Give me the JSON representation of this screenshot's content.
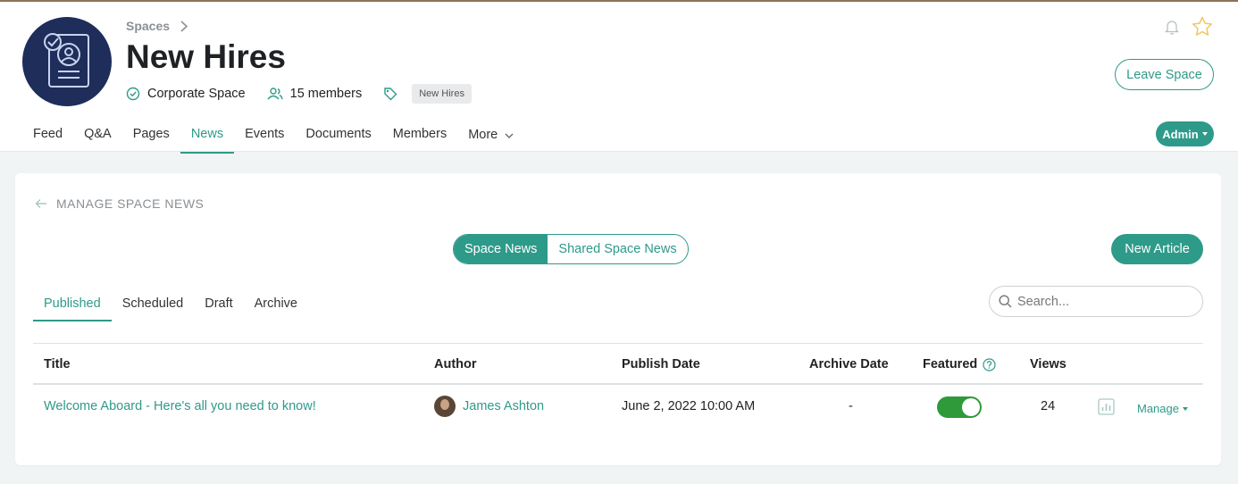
{
  "header": {
    "breadcrumb": "Spaces",
    "title": "New Hires",
    "space_type": "Corporate Space",
    "members": "15 members",
    "tag": "New Hires",
    "leave_label": "Leave Space",
    "admin_label": "Admin"
  },
  "nav": {
    "tabs": [
      "Feed",
      "Q&A",
      "Pages",
      "News",
      "Events",
      "Documents",
      "Members",
      "More"
    ],
    "active": "News"
  },
  "card": {
    "heading": "MANAGE SPACE NEWS",
    "segments": [
      "Space News",
      "Shared Space News"
    ],
    "active_segment": "Space News",
    "new_article_label": "New Article",
    "subtabs": [
      "Published",
      "Scheduled",
      "Draft",
      "Archive"
    ],
    "active_subtab": "Published",
    "search_placeholder": "Search..."
  },
  "table": {
    "columns": [
      "Title",
      "Author",
      "Publish Date",
      "Archive Date",
      "Featured",
      "Views"
    ],
    "rows": [
      {
        "title": "Welcome Aboard - Here's all you need to know!",
        "author": "James Ashton",
        "publish_date": "June 2, 2022 10:00 AM",
        "archive_date": "-",
        "featured": true,
        "views": "24",
        "manage_label": "Manage"
      }
    ]
  },
  "colors": {
    "accent": "#2e9a8a",
    "toggle_on": "#2e9a3a",
    "logo_bg": "#1e2d5a",
    "star": "#f0c75e"
  }
}
